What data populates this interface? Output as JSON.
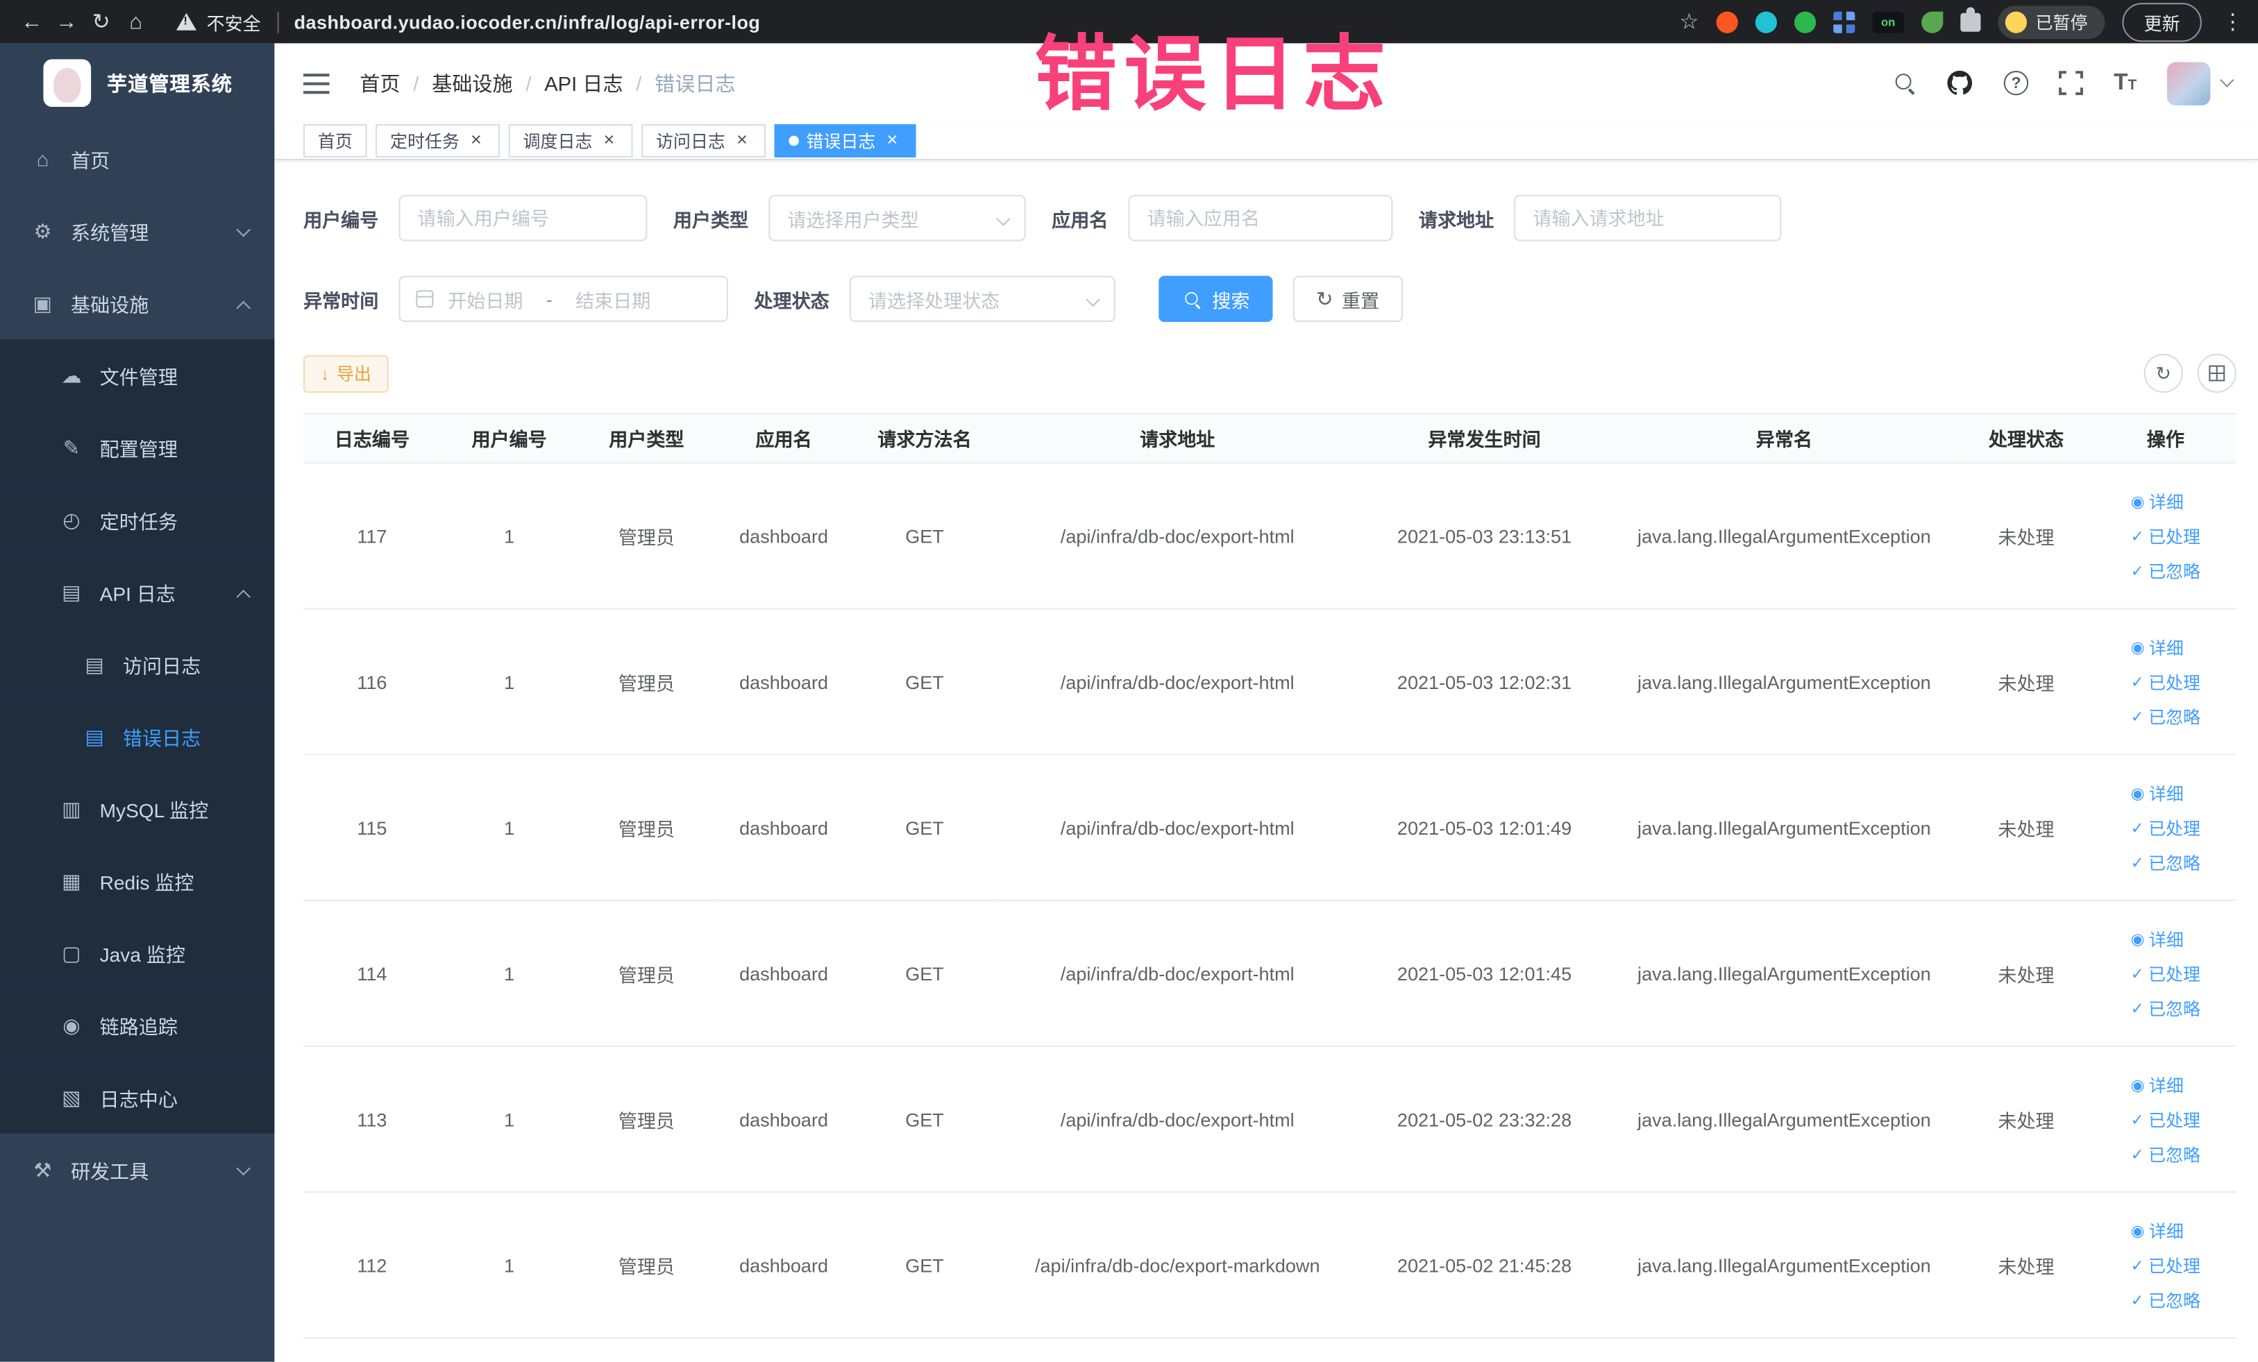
{
  "overlay": {
    "text": "错误日志",
    "color": "#f8407a"
  },
  "browser": {
    "security_label": "不安全",
    "url": "dashboard.yudao.iocoder.cn/infra/log/api-error-log",
    "paused_badge": "已暂停",
    "update_button": "更新",
    "extension_on_badge": "on"
  },
  "sidebar": {
    "title": "芋道管理系统",
    "items": [
      {
        "key": "home",
        "label": "首页",
        "level": 1
      },
      {
        "key": "system",
        "label": "系统管理",
        "level": 1,
        "chevron": "down"
      },
      {
        "key": "infra",
        "label": "基础设施",
        "level": 1,
        "chevron": "up"
      },
      {
        "key": "file",
        "label": "文件管理",
        "level": 2,
        "sub": true
      },
      {
        "key": "config",
        "label": "配置管理",
        "level": 2,
        "sub": true
      },
      {
        "key": "job",
        "label": "定时任务",
        "level": 2,
        "sub": true
      },
      {
        "key": "api-log",
        "label": "API 日志",
        "level": 2,
        "sub": true,
        "chevron": "up"
      },
      {
        "key": "access-log",
        "label": "访问日志",
        "level": 3,
        "sub": true
      },
      {
        "key": "error-log",
        "label": "错误日志",
        "level": 3,
        "sub": true,
        "active": true
      },
      {
        "key": "mysql",
        "label": "MySQL 监控",
        "level": 2,
        "sub": true
      },
      {
        "key": "redis",
        "label": "Redis 监控",
        "level": 2,
        "sub": true
      },
      {
        "key": "java",
        "label": "Java 监控",
        "level": 2,
        "sub": true
      },
      {
        "key": "trace",
        "label": "链路追踪",
        "level": 2,
        "sub": true
      },
      {
        "key": "log-center",
        "label": "日志中心",
        "level": 2,
        "sub": true
      },
      {
        "key": "dev-tools",
        "label": "研发工具",
        "level": 1,
        "chevron": "down"
      }
    ]
  },
  "breadcrumb": [
    "首页",
    "基础设施",
    "API 日志",
    "错误日志"
  ],
  "tabs": [
    {
      "label": "首页",
      "closable": false,
      "active": false
    },
    {
      "label": "定时任务",
      "closable": true,
      "active": false
    },
    {
      "label": "调度日志",
      "closable": true,
      "active": false
    },
    {
      "label": "访问日志",
      "closable": true,
      "active": false
    },
    {
      "label": "错误日志",
      "closable": true,
      "active": true
    }
  ],
  "filters": {
    "user_id_label": "用户编号",
    "user_id_placeholder": "请输入用户编号",
    "user_type_label": "用户类型",
    "user_type_placeholder": "请选择用户类型",
    "app_name_label": "应用名",
    "app_name_placeholder": "请输入应用名",
    "request_url_label": "请求地址",
    "request_url_placeholder": "请输入请求地址",
    "exception_time_label": "异常时间",
    "date_start_placeholder": "开始日期",
    "date_separator": "-",
    "date_end_placeholder": "结束日期",
    "process_status_label": "处理状态",
    "process_status_placeholder": "请选择处理状态",
    "search_button": "搜索",
    "reset_button": "重置"
  },
  "toolbar": {
    "export_button": "导出"
  },
  "table": {
    "columns": [
      "日志编号",
      "用户编号",
      "用户类型",
      "应用名",
      "请求方法名",
      "请求地址",
      "异常发生时间",
      "异常名",
      "处理状态",
      "操作"
    ],
    "actions": [
      "详细",
      "已处理",
      "已忽略"
    ],
    "rows": [
      {
        "id": "117",
        "user_id": "1",
        "user_type": "管理员",
        "app": "dashboard",
        "method": "GET",
        "url": "/api/infra/db-doc/export-html",
        "time": "2021-05-03 23:13:51",
        "exception": "java.lang.IllegalArgumentException",
        "status": "未处理"
      },
      {
        "id": "116",
        "user_id": "1",
        "user_type": "管理员",
        "app": "dashboard",
        "method": "GET",
        "url": "/api/infra/db-doc/export-html",
        "time": "2021-05-03 12:02:31",
        "exception": "java.lang.IllegalArgumentException",
        "status": "未处理"
      },
      {
        "id": "115",
        "user_id": "1",
        "user_type": "管理员",
        "app": "dashboard",
        "method": "GET",
        "url": "/api/infra/db-doc/export-html",
        "time": "2021-05-03 12:01:49",
        "exception": "java.lang.IllegalArgumentException",
        "status": "未处理"
      },
      {
        "id": "114",
        "user_id": "1",
        "user_type": "管理员",
        "app": "dashboard",
        "method": "GET",
        "url": "/api/infra/db-doc/export-html",
        "time": "2021-05-03 12:01:45",
        "exception": "java.lang.IllegalArgumentException",
        "status": "未处理"
      },
      {
        "id": "113",
        "user_id": "1",
        "user_type": "管理员",
        "app": "dashboard",
        "method": "GET",
        "url": "/api/infra/db-doc/export-html",
        "time": "2021-05-02 23:32:28",
        "exception": "java.lang.IllegalArgumentException",
        "status": "未处理"
      },
      {
        "id": "112",
        "user_id": "1",
        "user_type": "管理员",
        "app": "dashboard",
        "method": "GET",
        "url": "/api/infra/db-doc/export-markdown",
        "time": "2021-05-02 21:45:28",
        "exception": "java.lang.IllegalArgumentException",
        "status": "未处理"
      }
    ]
  }
}
